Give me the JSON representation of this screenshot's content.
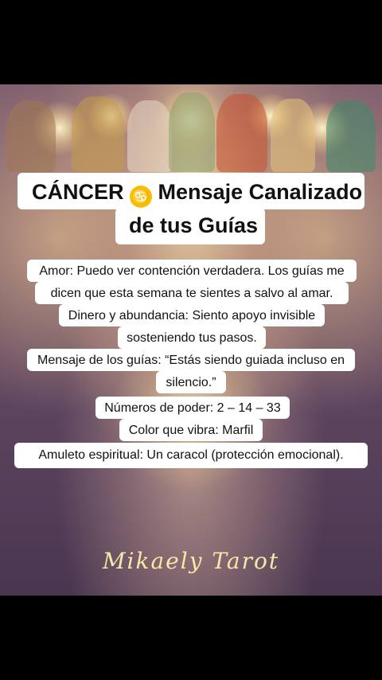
{
  "title": {
    "line1_prefix": "CÁNCER",
    "sign_glyph": "♋",
    "line1_suffix": "Mensaje Canalizado",
    "line2": "de tus Guías"
  },
  "message_lines": [
    "Amor: Puedo ver contención verdadera. Los guías me",
    "dicen que esta semana te sientes a salvo al amar.",
    "Dinero y abundancia: Siento apoyo invisible",
    "sosteniendo tus pasos.",
    "Mensaje de los guías: “Estás siendo guiada incluso en",
    "silencio.”",
    "Números de poder: 2 – 14 – 33",
    "Color que vibra: Marfil",
    "Amuleto espiritual: Un caracol (protección emocional)."
  ],
  "watermark": "Mikaely Tarot",
  "colors": {
    "background": "#000000",
    "sign_badge": "#f5c000",
    "watermark": "#f7e7a8"
  },
  "icons": {
    "sign": "cancer-zodiac-icon"
  }
}
